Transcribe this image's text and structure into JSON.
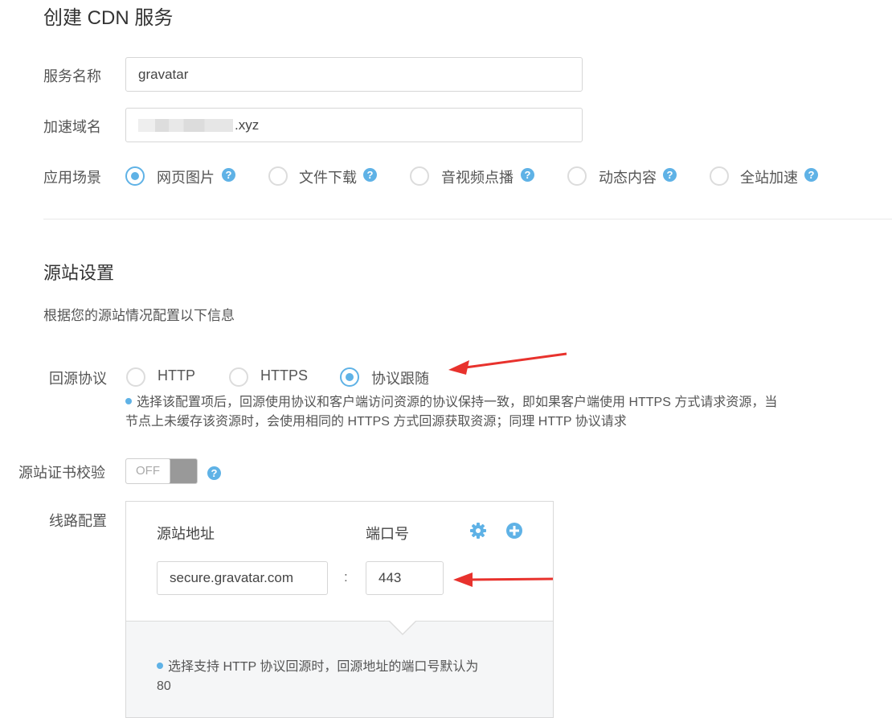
{
  "page": {
    "title": "创建 CDN 服务"
  },
  "service_name": {
    "label": "服务名称",
    "value": "gravatar"
  },
  "domain": {
    "label": "加速域名",
    "value_suffix": ".xyz"
  },
  "scenario": {
    "label": "应用场景",
    "options": [
      {
        "label": "网页图片",
        "selected": true
      },
      {
        "label": "文件下载",
        "selected": false
      },
      {
        "label": "音视频点播",
        "selected": false
      },
      {
        "label": "动态内容",
        "selected": false
      },
      {
        "label": "全站加速",
        "selected": false
      }
    ]
  },
  "origin": {
    "section_title": "源站设置",
    "description": "根据您的源站情况配置以下信息",
    "protocol": {
      "label": "回源协议",
      "options": [
        {
          "label": "HTTP",
          "selected": false
        },
        {
          "label": "HTTPS",
          "selected": false
        },
        {
          "label": "协议跟随",
          "selected": true
        }
      ],
      "note_line1": "选择该配置项后，回源使用协议和客户端访问资源的协议保持一致，即如果客户端使用 HTTPS 方式请求资源，当",
      "note_line2": "节点上未缓存该资源时，会使用相同的 HTTPS 方式回源获取资源；同理 HTTP 协议请求"
    },
    "cert_check": {
      "label": "源站证书校验",
      "toggle_text": "OFF",
      "enabled": false
    },
    "route": {
      "label": "线路配置",
      "col_address": "源站地址",
      "col_port": "端口号",
      "address_value": "secure.gravatar.com",
      "separator": ":",
      "port_value": "443",
      "tip_line1": "选择支持 HTTP 协议回源时，回源地址的端口号默认为",
      "tip_line2": "80"
    }
  },
  "icons": {
    "help": "question-circle-icon",
    "settings": "gear-icon",
    "add": "plus-circle-icon",
    "annotation": "red-arrow-icon"
  },
  "colors": {
    "accent": "#5fb2e6",
    "annotation": "#e8322d"
  }
}
